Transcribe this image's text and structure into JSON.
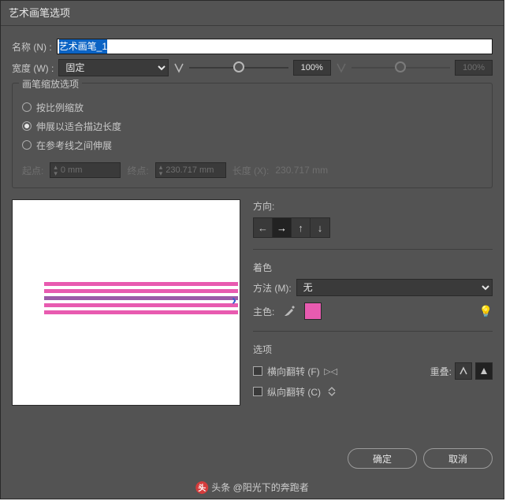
{
  "dialog": {
    "title": "艺术画笔选项",
    "name_label": "名称 (N) :",
    "name_value": "艺术画笔_1",
    "width_label": "宽度 (W) :",
    "width_mode": "固定",
    "width_pct_left": "100%",
    "width_pct_right": "100%"
  },
  "scale": {
    "legend": "画笔缩放选项",
    "opts": [
      {
        "label": "按比例缩放",
        "checked": false
      },
      {
        "label": "伸展以适合描边长度",
        "checked": true
      },
      {
        "label": "在参考线之间伸展",
        "checked": false
      }
    ],
    "start_label": "起点:",
    "start_value": "0 mm",
    "end_label": "终点:",
    "end_value": "230.717 mm",
    "length_label": "长度 (X):",
    "length_value": "230.717 mm"
  },
  "preview": {
    "swatch_color": "#e85bb0"
  },
  "direction": {
    "header": "方向:",
    "active_index": 1
  },
  "coloring": {
    "header": "着色",
    "method_label": "方法 (M):",
    "method_value": "无",
    "key_label": "主色:"
  },
  "options": {
    "header": "选项",
    "flip_h": "横向翻转 (F)",
    "flip_v": "纵向翻转 (C)",
    "overlap_label": "重叠:"
  },
  "footer": {
    "ok": "确定",
    "cancel": "取消"
  },
  "watermark": "头条 @阳光下的奔跑者"
}
